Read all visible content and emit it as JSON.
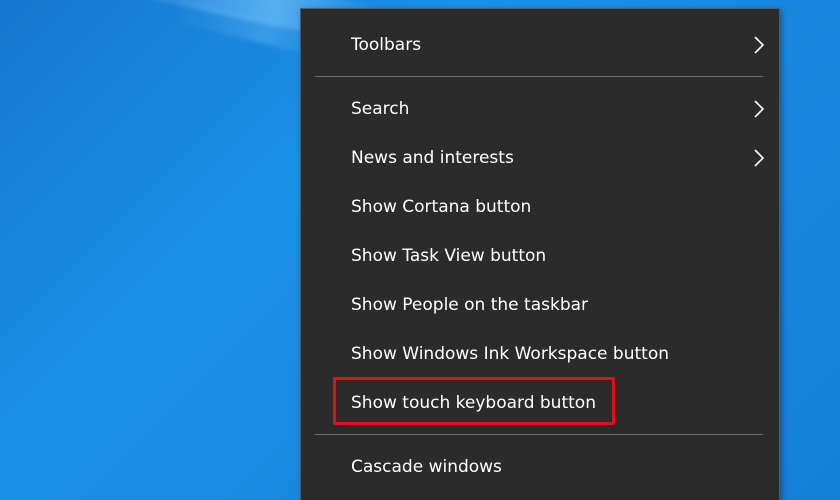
{
  "context_menu": {
    "items": [
      {
        "label": "Toolbars",
        "submenu": true
      },
      {
        "label": "Search",
        "submenu": true
      },
      {
        "label": "News and interests",
        "submenu": true
      },
      {
        "label": "Show Cortana button",
        "submenu": false
      },
      {
        "label": "Show Task View button",
        "submenu": false
      },
      {
        "label": "Show People on the taskbar",
        "submenu": false
      },
      {
        "label": "Show Windows Ink Workspace button",
        "submenu": false
      },
      {
        "label": "Show touch keyboard button",
        "submenu": false,
        "highlighted": true
      },
      {
        "label": "Cascade windows",
        "submenu": false
      }
    ]
  },
  "colors": {
    "menu_background": "#2b2b2b",
    "menu_text": "#ffffff",
    "highlight_border": "#e0101c",
    "desktop_blue": "#1a88e0"
  },
  "icons": {
    "submenu": "chevron-right-icon"
  }
}
